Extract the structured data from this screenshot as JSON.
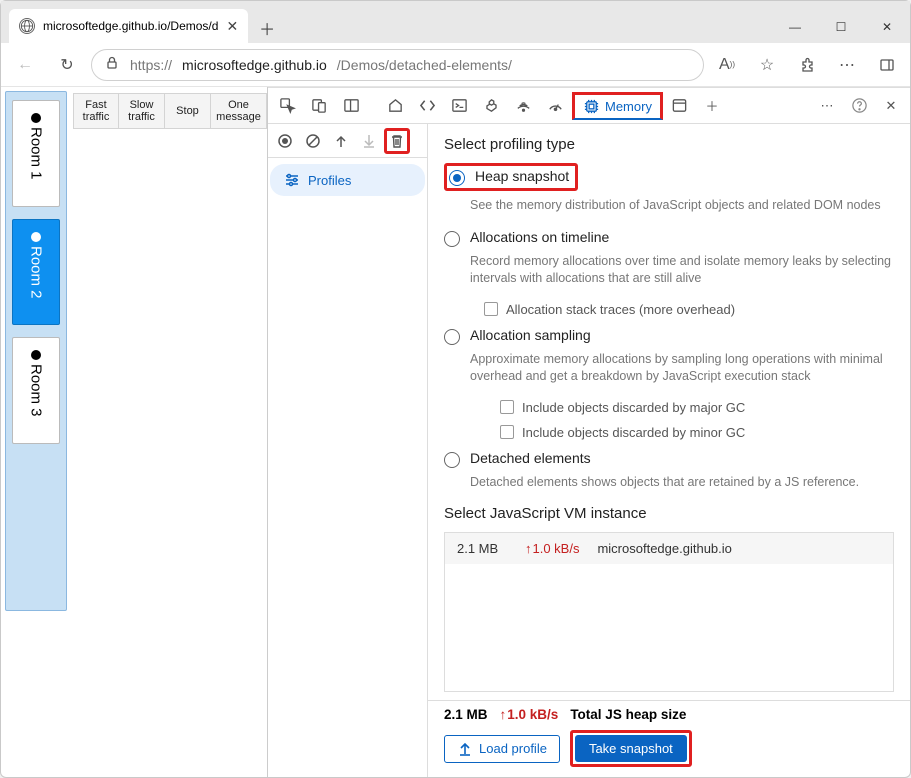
{
  "window": {
    "tab_title": "microsoftedge.github.io/Demos/d",
    "url_host": "microsoftedge.github.io",
    "url_prefix": "https://",
    "url_path": "/Demos/detached-elements/"
  },
  "page": {
    "rooms": [
      {
        "label": "Room 1",
        "active": false
      },
      {
        "label": "Room 2",
        "active": true
      },
      {
        "label": "Room 3",
        "active": false
      }
    ],
    "buttons": [
      "Fast traffic",
      "Slow traffic",
      "Stop",
      "One message"
    ]
  },
  "devtools": {
    "memory_tab": "Memory",
    "profiles_label": "Profiles",
    "section_title": "Select profiling type",
    "options": [
      {
        "label": "Heap snapshot",
        "desc": "See the memory distribution of JavaScript objects and related DOM nodes",
        "checked": true,
        "highlight": true
      },
      {
        "label": "Allocations on timeline",
        "desc": "Record memory allocations over time and isolate memory leaks by selecting intervals with allocations that are still alive",
        "checked": false,
        "extras": [
          "Allocation stack traces (more overhead)"
        ]
      },
      {
        "label": "Allocation sampling",
        "desc": "Approximate memory allocations by sampling long operations with minimal overhead and get a breakdown by JavaScript execution stack",
        "checked": false,
        "extras": [
          "Include objects discarded by major GC",
          "Include objects discarded by minor GC"
        ]
      },
      {
        "label": "Detached elements",
        "desc": "Detached elements shows objects that are retained by a JS reference.",
        "checked": false
      }
    ],
    "vm_title": "Select JavaScript VM instance",
    "vm_row": {
      "mb": "2.1 MB",
      "kbs": "1.0 kB/s",
      "host": "microsoftedge.github.io"
    },
    "footer": {
      "mb": "2.1 MB",
      "kbs": "1.0 kB/s",
      "label": "Total JS heap size",
      "load": "Load profile",
      "take": "Take snapshot"
    }
  }
}
